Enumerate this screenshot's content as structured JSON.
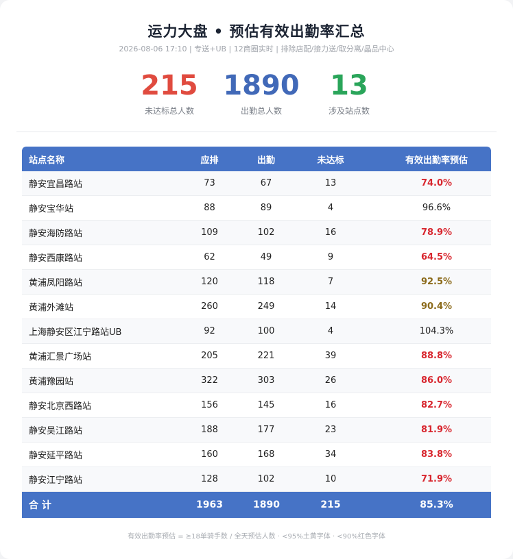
{
  "header": {
    "title": "运力大盘 • 预估有效出勤率汇总",
    "subtitle": "2026-08-06 17:10 | 专送+UB | 12商圈实时 | 排除店配/接力送/取分离/晶品中心"
  },
  "stats": [
    {
      "value": "215",
      "label": "未达标总人数",
      "color": "#e04b3f"
    },
    {
      "value": "1890",
      "label": "出勤总人数",
      "color": "#4169b8"
    },
    {
      "value": "13",
      "label": "涉及站点数",
      "color": "#2aa55a"
    }
  ],
  "table": {
    "headers": [
      "站点名称",
      "应排",
      "出勤",
      "未达标",
      "有效出勤率预估"
    ],
    "rows": [
      {
        "name": "静安宜昌路站",
        "plan": "73",
        "attend": "67",
        "miss": "13",
        "rate": "74.0%",
        "level": "red"
      },
      {
        "name": "静安宝华站",
        "plan": "88",
        "attend": "89",
        "miss": "4",
        "rate": "96.6%",
        "level": "normal"
      },
      {
        "name": "静安海防路站",
        "plan": "109",
        "attend": "102",
        "miss": "16",
        "rate": "78.9%",
        "level": "red"
      },
      {
        "name": "静安西康路站",
        "plan": "62",
        "attend": "49",
        "miss": "9",
        "rate": "64.5%",
        "level": "red"
      },
      {
        "name": "黄浦凤阳路站",
        "plan": "120",
        "attend": "118",
        "miss": "7",
        "rate": "92.5%",
        "level": "yellow"
      },
      {
        "name": "黄浦外滩站",
        "plan": "260",
        "attend": "249",
        "miss": "14",
        "rate": "90.4%",
        "level": "yellow"
      },
      {
        "name": "上海静安区江宁路站UB",
        "plan": "92",
        "attend": "100",
        "miss": "4",
        "rate": "104.3%",
        "level": "normal"
      },
      {
        "name": "黄浦汇景广场站",
        "plan": "205",
        "attend": "221",
        "miss": "39",
        "rate": "88.8%",
        "level": "red"
      },
      {
        "name": "黄浦豫园站",
        "plan": "322",
        "attend": "303",
        "miss": "26",
        "rate": "86.0%",
        "level": "red"
      },
      {
        "name": "静安北京西路站",
        "plan": "156",
        "attend": "145",
        "miss": "16",
        "rate": "82.7%",
        "level": "red"
      },
      {
        "name": "静安吴江路站",
        "plan": "188",
        "attend": "177",
        "miss": "23",
        "rate": "81.9%",
        "level": "red"
      },
      {
        "name": "静安延平路站",
        "plan": "160",
        "attend": "168",
        "miss": "34",
        "rate": "83.8%",
        "level": "red"
      },
      {
        "name": "静安江宁路站",
        "plan": "128",
        "attend": "102",
        "miss": "10",
        "rate": "71.9%",
        "level": "red"
      }
    ],
    "total": {
      "name": "合 计",
      "plan": "1963",
      "attend": "1890",
      "miss": "215",
      "rate": "85.3%"
    },
    "colors": {
      "header_bg": "#4673c6",
      "red": "#d8262e",
      "yellow": "#8b6a1a"
    }
  },
  "footer": {
    "note": "有效出勤率预估 = ≥18单骑手数 / 全天预估人数 · <95%土黄字体 · <90%红色字体"
  }
}
